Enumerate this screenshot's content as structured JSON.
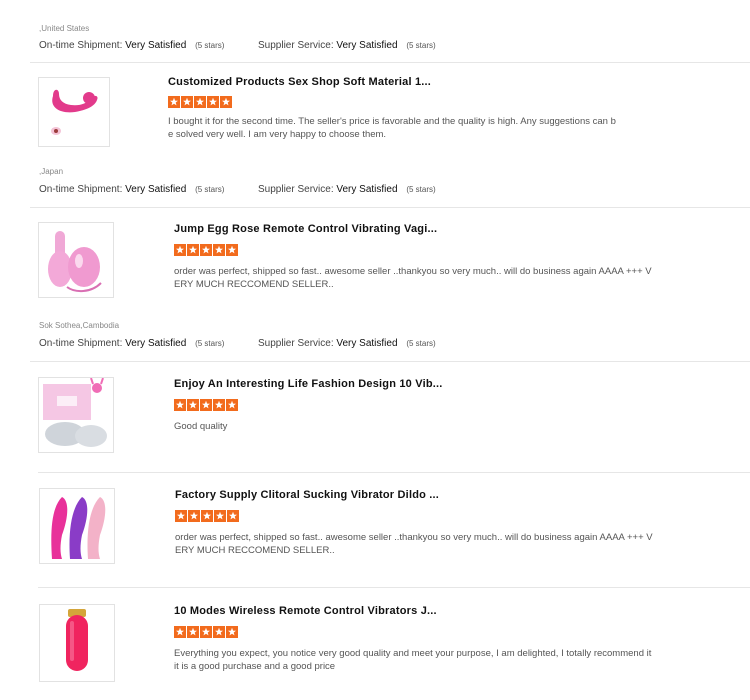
{
  "labels": {
    "ontime": "On-time Shipment:",
    "supplier": "Supplier Service:"
  },
  "colors": {
    "star": "#f26b1d",
    "divider": "#e6e6e6"
  },
  "reviewer_blocks": [
    {
      "location": ",United States",
      "ontime_value": "Very Satisfied",
      "ontime_stars": "(5 stars)",
      "supplier_value": "Very Satisfied",
      "supplier_stars": "(5 stars)"
    },
    {
      "location": ",Japan",
      "ontime_value": "Very Satisfied",
      "ontime_stars": "(5 stars)",
      "supplier_value": "Very Satisfied",
      "supplier_stars": "(5 stars)"
    },
    {
      "location": "Sok Sothea,Cambodia",
      "ontime_value": "Very Satisfied",
      "ontime_stars": "(5 stars)",
      "supplier_value": "Very Satisfied",
      "supplier_stars": "(5 stars)"
    }
  ],
  "reviews": [
    {
      "title": "Customized Products Sex Shop Soft Material 1...",
      "stars": 5,
      "image": "pink-u-shaped-product-image",
      "text": "I bought it for the second time. The seller's price is favorable and the quality is high. Any suggestions can be solved very well. I am very happy to choose them."
    },
    {
      "title": "Jump Egg Rose Remote Control Vibrating Vagi...",
      "stars": 5,
      "image": "pink-egg-remote-image",
      "text": "order was perfect, shipped so fast.. awesome seller ..thankyou so very much.. will do business again AAAA +++ VERY MUCH RECCOMEND SELLER.."
    },
    {
      "title": "Enjoy An Interesting Life Fashion Design 10 Vib...",
      "stars": 5,
      "image": "packaging-box-image",
      "text": "Good quality"
    },
    {
      "title": "Factory Supply Clitoral Sucking Vibrator Dildo ...",
      "stars": 5,
      "image": "three-vibrators-image",
      "text": "order was perfect, shipped so fast.. awesome seller ..thankyou so very much.. will do business again AAAA +++ VERY MUCH RECCOMEND SELLER.."
    },
    {
      "title": "10 Modes Wireless Remote Control Vibrators J...",
      "stars": 5,
      "image": "pink-bullet-image",
      "text": "Everything you expect, you notice very good quality and meet your purpose, I am delighted, I totally recommend it it is a good purchase and a good price"
    }
  ]
}
